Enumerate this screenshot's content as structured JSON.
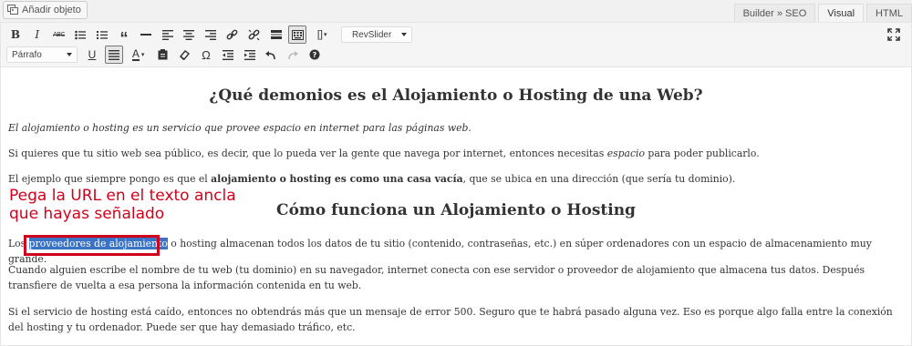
{
  "toolbar_top": {
    "add_media_label": "Añadir objeto",
    "tabs": [
      {
        "label": "Builder » SEO"
      },
      {
        "label": "Visual"
      },
      {
        "label": "HTML"
      }
    ]
  },
  "editor_toolbar": {
    "format_select": "Párrafo",
    "revslider_select": "RevSlider"
  },
  "content": {
    "heading_1": "¿Qué demonios es el Alojamiento o Hosting de una Web?",
    "p1": "El alojamiento o hosting es un servicio que provee espacio en internet para las páginas web.",
    "p2_before": "Si quieres que tu sitio web sea público, es decir, que lo pueda ver la gente que navega por internet, entonces necesitas ",
    "p2_em": "espacio",
    "p2_after": " para poder publicarlo.",
    "p3_before": "El ejemplo que siempre pongo es que el ",
    "p3_bold": "alojamiento o hosting es como una casa vacía",
    "p3_after": ", que se ubica en una dirección (que sería tu dominio).",
    "heading_2": "Cómo funciona un Alojamiento o Hosting",
    "p4_before": "Los ",
    "p4_highlight": "proveedores de alojamiento",
    "p4_after": " o hosting almacenan todos los datos de tu sitio (contenido, contraseñas, etc.) en súper ordenadores con un espacio de almacenamiento muy grande.",
    "p5": "Cuando alguien escribe el nombre de tu web (tu dominio) en su navegador, internet conecta con ese servidor o proveedor de alojamiento que almacena tus datos. Después transfiere de vuelta a esa persona la información contenida en tu web.",
    "p6": "Si el servicio de hosting está caído, entonces no obtendrás más que un mensaje de error 500. Seguro que te habrá pasado alguna vez. Eso es porque algo falla entre la conexión del hosting y tu ordenador. Puede ser que hay demasiado tráfico, etc."
  },
  "annotation": {
    "line1": "Pega la URL en el texto ancla",
    "line2": "que hayas señalado",
    "color": "#d0021b"
  },
  "colors": {
    "highlight": "#3a73c4",
    "text": "#333333"
  }
}
